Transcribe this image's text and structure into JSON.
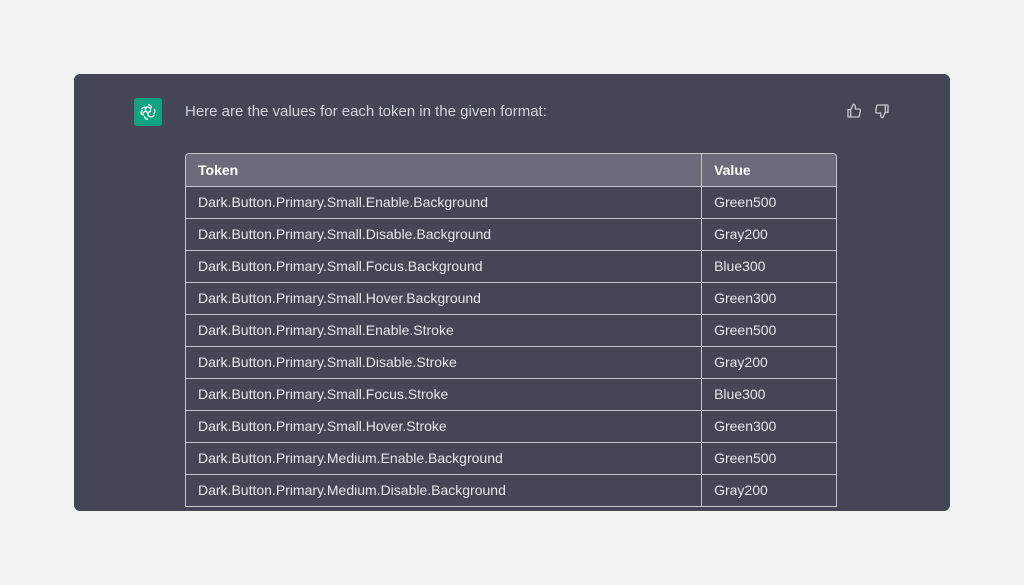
{
  "message": {
    "text": "Here are the values for each token in the given format:"
  },
  "icons": {
    "avatar": "chatgpt-logo-icon",
    "like": "thumbs-up-icon",
    "dislike": "thumbs-down-icon"
  },
  "colors": {
    "avatar_bg": "#10a37f",
    "panel_bg": "#444654",
    "header_bg": "#6b6c7b"
  },
  "table": {
    "headers": [
      "Token",
      "Value"
    ],
    "rows": [
      [
        "Dark.Button.Primary.Small.Enable.Background",
        "Green500"
      ],
      [
        "Dark.Button.Primary.Small.Disable.Background",
        "Gray200"
      ],
      [
        "Dark.Button.Primary.Small.Focus.Background",
        "Blue300"
      ],
      [
        "Dark.Button.Primary.Small.Hover.Background",
        "Green300"
      ],
      [
        "Dark.Button.Primary.Small.Enable.Stroke",
        "Green500"
      ],
      [
        "Dark.Button.Primary.Small.Disable.Stroke",
        "Gray200"
      ],
      [
        "Dark.Button.Primary.Small.Focus.Stroke",
        "Blue300"
      ],
      [
        "Dark.Button.Primary.Small.Hover.Stroke",
        "Green300"
      ],
      [
        "Dark.Button.Primary.Medium.Enable.Background",
        "Green500"
      ],
      [
        "Dark.Button.Primary.Medium.Disable.Background",
        "Gray200"
      ]
    ]
  }
}
